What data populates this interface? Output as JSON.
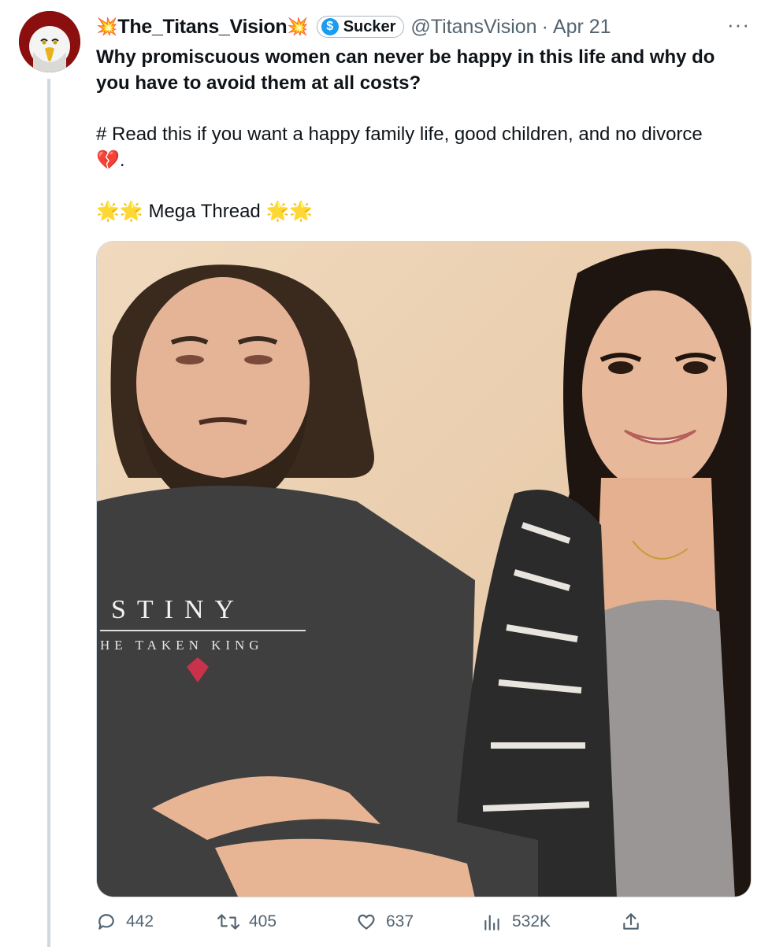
{
  "tweet": {
    "display_name": "The_Titans_Vision",
    "name_decoration": "💥",
    "badge_icon": "$",
    "badge_label": "Sucker",
    "handle": "@TitansVision",
    "separator": "·",
    "date": "Apr 21",
    "more": "···",
    "title": "Why promiscuous women can never be happy in this life and why do you have to avoid them at all costs?",
    "line1": "# Read this if you want a happy family life, good children, and no divorce",
    "broken_heart": "💔",
    "line1_end": ".",
    "star": "🌟",
    "thread_label": "Mega Thread"
  },
  "media": {
    "shirt_line1": "STINY",
    "shirt_line2": "HE TAKEN KING"
  },
  "stats": {
    "replies": "442",
    "reposts": "405",
    "likes": "637",
    "views": "532K"
  },
  "icons": {
    "reply": "reply-icon",
    "repost": "repost-icon",
    "like": "heart-icon",
    "views": "views-icon",
    "share": "share-icon"
  },
  "colors": {
    "text": "#0f1419",
    "secondary": "#536471",
    "accent": "#1d9bf0",
    "thread_line": "#cfd9de"
  }
}
